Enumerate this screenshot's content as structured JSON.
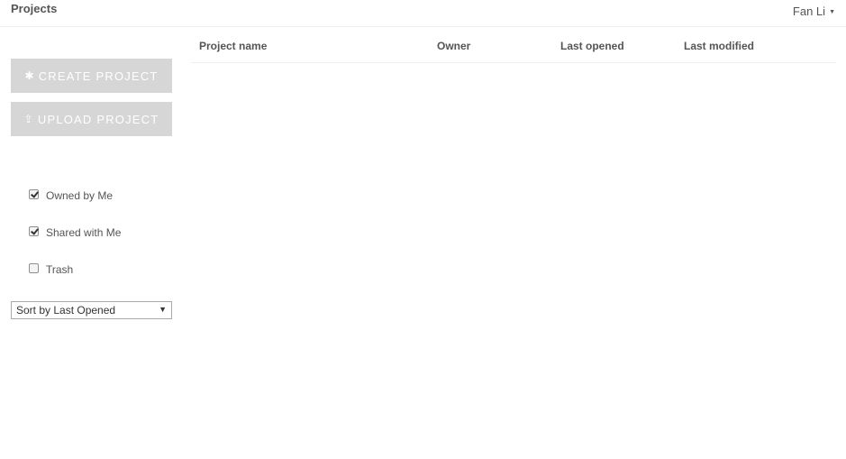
{
  "header": {
    "title": "Projects",
    "user_name": "Fan Li"
  },
  "sidebar": {
    "create_button": {
      "icon": "asterisk-icon",
      "label": "CREATE PROJECT"
    },
    "upload_button": {
      "icon": "upload-icon",
      "label": "UPLOAD PROJECT"
    },
    "filters": [
      {
        "label": "Owned by Me",
        "checked": true
      },
      {
        "label": "Shared with Me",
        "checked": true
      },
      {
        "label": "Trash",
        "checked": false
      }
    ],
    "sort": {
      "selected": "Sort by Last Opened"
    }
  },
  "table": {
    "columns": [
      "Project name",
      "Owner",
      "Last opened",
      "Last modified"
    ],
    "rows": []
  },
  "colors": {
    "button_bg": "#d6d6d6",
    "text": "#555555",
    "divider": "#eeeeee"
  }
}
